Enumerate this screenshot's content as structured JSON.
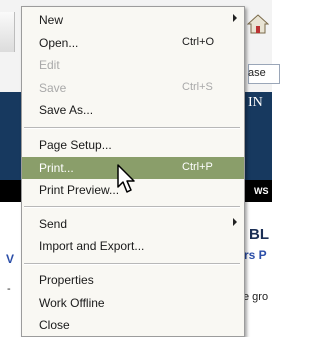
{
  "background": {
    "fragments": {
      "ase": "ase",
      "in": "IN",
      "ws": "WS",
      "bl": "BL",
      "rs_p": "rs P",
      "v": "V",
      "gro": "e gro",
      "dash": "-"
    }
  },
  "menu": {
    "items": {
      "new": {
        "label": "New",
        "submenu": true
      },
      "open": {
        "label": "Open...",
        "accel": "Ctrl+O"
      },
      "edit": {
        "label": "Edit",
        "disabled": true
      },
      "save": {
        "label": "Save",
        "accel": "Ctrl+S",
        "disabled": true
      },
      "save_as": {
        "label": "Save As..."
      },
      "page_setup": {
        "label": "Page Setup..."
      },
      "print": {
        "label": "Print...",
        "accel": "Ctrl+P",
        "highlighted": true
      },
      "print_preview": {
        "label": "Print Preview..."
      },
      "send": {
        "label": "Send",
        "submenu": true
      },
      "import_export": {
        "label": "Import and Export..."
      },
      "properties": {
        "label": "Properties"
      },
      "work_offline": {
        "label": "Work Offline"
      },
      "close": {
        "label": "Close"
      }
    }
  },
  "colors": {
    "highlight": "#8a9e6a",
    "menu_bg": "#f9f8f3",
    "header_bar": "#17395f"
  }
}
